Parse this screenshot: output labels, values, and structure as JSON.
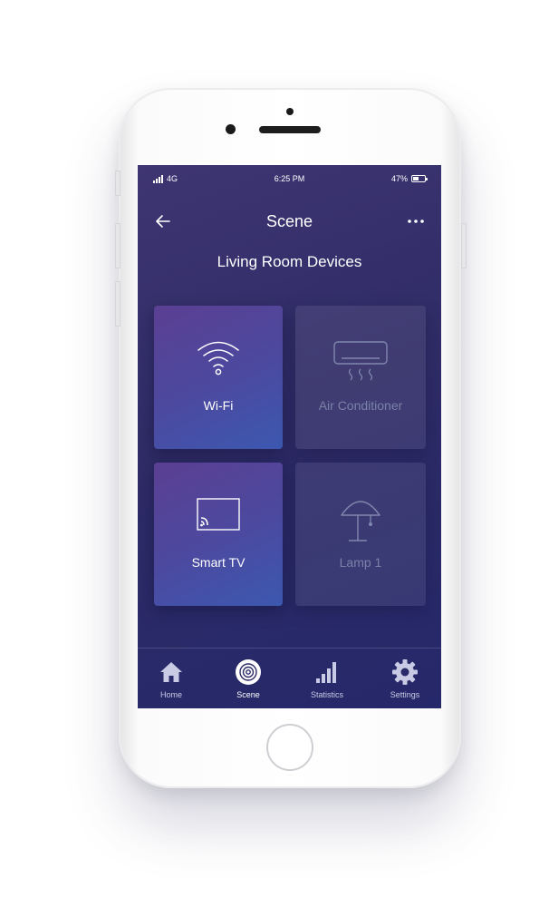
{
  "status_bar": {
    "carrier": "4G",
    "time": "6:25 PM",
    "battery": "47%",
    "battery_level": 0.47
  },
  "header": {
    "title": "Scene",
    "back_icon": "arrow-left-icon",
    "more_icon": "more-dots-icon"
  },
  "room": {
    "title": "Living Room Devices"
  },
  "devices": [
    {
      "label": "Wi-Fi",
      "icon": "wifi-icon",
      "active": true
    },
    {
      "label": "Air Conditioner",
      "icon": "air-conditioner-icon",
      "active": false
    },
    {
      "label": "Smart TV",
      "icon": "cast-tv-icon",
      "active": true
    },
    {
      "label": "Lamp 1",
      "icon": "lamp-icon",
      "active": false
    }
  ],
  "tabs": [
    {
      "label": "Home",
      "icon": "home-icon"
    },
    {
      "label": "Scene",
      "icon": "scene-icon",
      "active": true
    },
    {
      "label": "Statistics",
      "icon": "statistics-icon"
    },
    {
      "label": "Settings",
      "icon": "gear-icon"
    }
  ],
  "colors": {
    "screen_bg": "#2f2c67",
    "tile_active": "#4b4aa0",
    "tile_inactive_text": "#7a82a8"
  }
}
